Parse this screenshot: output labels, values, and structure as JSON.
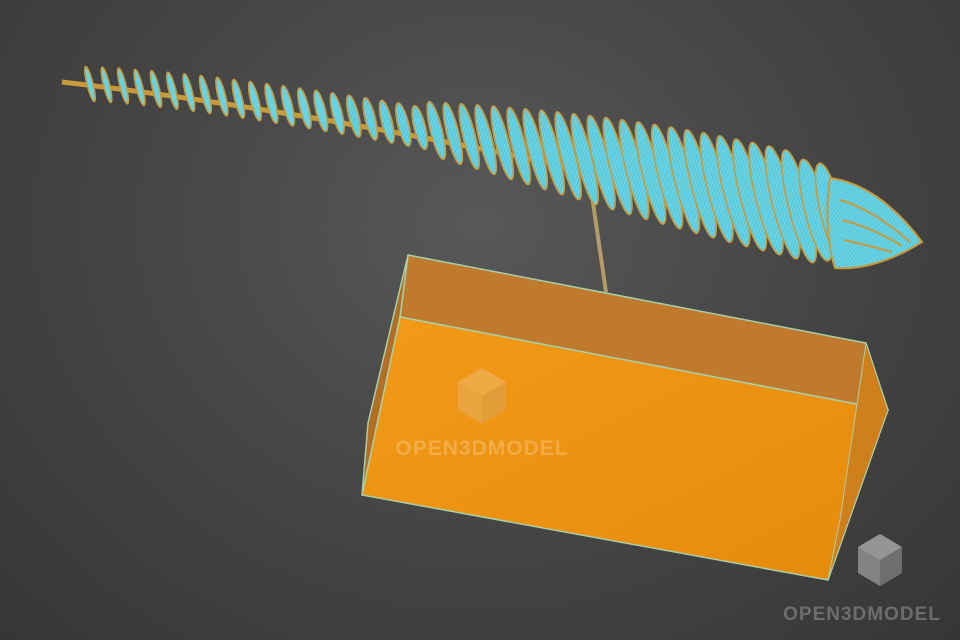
{
  "watermark": {
    "brand": "OPEN3DMODEL"
  },
  "colors": {
    "background": "#474747",
    "sculpture_fill": "#66d4e6",
    "sculpture_edge": "#c89a3c",
    "box_front": "#ee9110",
    "box_top": "#c2782a",
    "box_side": "#d68418",
    "box_edge": "#9ec9a8"
  },
  "scene": {
    "model": "fish-skeleton-sculpture",
    "rib_count": 46
  }
}
